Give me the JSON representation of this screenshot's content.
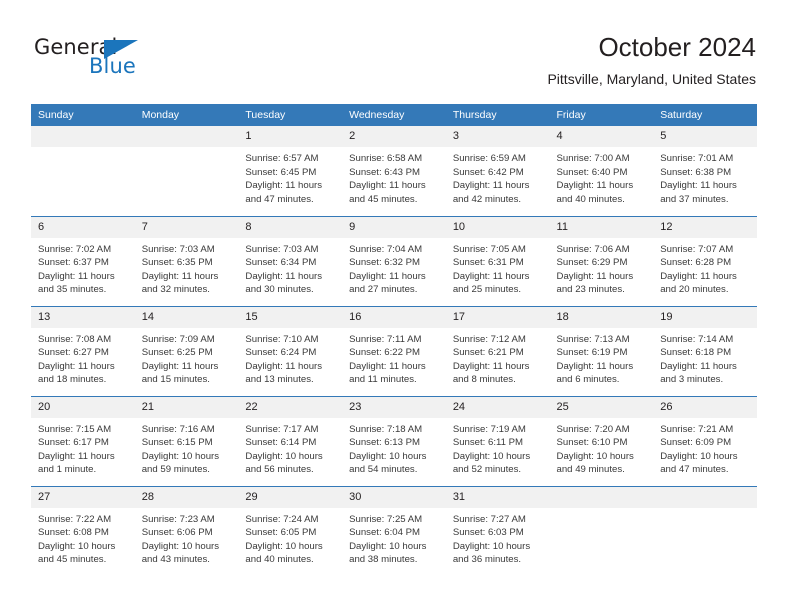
{
  "brand": {
    "name_part1": "General",
    "name_part2": "Blue",
    "flag_icon": "triangle-flag-icon",
    "accent_color": "#1b75bc"
  },
  "header": {
    "title": "October 2024",
    "location": "Pittsville, Maryland, United States"
  },
  "calendar": {
    "header_bg": "#3479b8",
    "daynum_bg": "#f1f1f1",
    "weekday_headers": [
      "Sunday",
      "Monday",
      "Tuesday",
      "Wednesday",
      "Thursday",
      "Friday",
      "Saturday"
    ],
    "weeks": [
      [
        {
          "date": "",
          "sunrise": "",
          "sunset": "",
          "daylight1": "",
          "daylight2": "",
          "empty": true
        },
        {
          "date": "",
          "sunrise": "",
          "sunset": "",
          "daylight1": "",
          "daylight2": "",
          "empty": true
        },
        {
          "date": "1",
          "sunrise": "Sunrise: 6:57 AM",
          "sunset": "Sunset: 6:45 PM",
          "daylight1": "Daylight: 11 hours",
          "daylight2": "and 47 minutes."
        },
        {
          "date": "2",
          "sunrise": "Sunrise: 6:58 AM",
          "sunset": "Sunset: 6:43 PM",
          "daylight1": "Daylight: 11 hours",
          "daylight2": "and 45 minutes."
        },
        {
          "date": "3",
          "sunrise": "Sunrise: 6:59 AM",
          "sunset": "Sunset: 6:42 PM",
          "daylight1": "Daylight: 11 hours",
          "daylight2": "and 42 minutes."
        },
        {
          "date": "4",
          "sunrise": "Sunrise: 7:00 AM",
          "sunset": "Sunset: 6:40 PM",
          "daylight1": "Daylight: 11 hours",
          "daylight2": "and 40 minutes."
        },
        {
          "date": "5",
          "sunrise": "Sunrise: 7:01 AM",
          "sunset": "Sunset: 6:38 PM",
          "daylight1": "Daylight: 11 hours",
          "daylight2": "and 37 minutes."
        }
      ],
      [
        {
          "date": "6",
          "sunrise": "Sunrise: 7:02 AM",
          "sunset": "Sunset: 6:37 PM",
          "daylight1": "Daylight: 11 hours",
          "daylight2": "and 35 minutes."
        },
        {
          "date": "7",
          "sunrise": "Sunrise: 7:03 AM",
          "sunset": "Sunset: 6:35 PM",
          "daylight1": "Daylight: 11 hours",
          "daylight2": "and 32 minutes."
        },
        {
          "date": "8",
          "sunrise": "Sunrise: 7:03 AM",
          "sunset": "Sunset: 6:34 PM",
          "daylight1": "Daylight: 11 hours",
          "daylight2": "and 30 minutes."
        },
        {
          "date": "9",
          "sunrise": "Sunrise: 7:04 AM",
          "sunset": "Sunset: 6:32 PM",
          "daylight1": "Daylight: 11 hours",
          "daylight2": "and 27 minutes."
        },
        {
          "date": "10",
          "sunrise": "Sunrise: 7:05 AM",
          "sunset": "Sunset: 6:31 PM",
          "daylight1": "Daylight: 11 hours",
          "daylight2": "and 25 minutes."
        },
        {
          "date": "11",
          "sunrise": "Sunrise: 7:06 AM",
          "sunset": "Sunset: 6:29 PM",
          "daylight1": "Daylight: 11 hours",
          "daylight2": "and 23 minutes."
        },
        {
          "date": "12",
          "sunrise": "Sunrise: 7:07 AM",
          "sunset": "Sunset: 6:28 PM",
          "daylight1": "Daylight: 11 hours",
          "daylight2": "and 20 minutes."
        }
      ],
      [
        {
          "date": "13",
          "sunrise": "Sunrise: 7:08 AM",
          "sunset": "Sunset: 6:27 PM",
          "daylight1": "Daylight: 11 hours",
          "daylight2": "and 18 minutes."
        },
        {
          "date": "14",
          "sunrise": "Sunrise: 7:09 AM",
          "sunset": "Sunset: 6:25 PM",
          "daylight1": "Daylight: 11 hours",
          "daylight2": "and 15 minutes."
        },
        {
          "date": "15",
          "sunrise": "Sunrise: 7:10 AM",
          "sunset": "Sunset: 6:24 PM",
          "daylight1": "Daylight: 11 hours",
          "daylight2": "and 13 minutes."
        },
        {
          "date": "16",
          "sunrise": "Sunrise: 7:11 AM",
          "sunset": "Sunset: 6:22 PM",
          "daylight1": "Daylight: 11 hours",
          "daylight2": "and 11 minutes."
        },
        {
          "date": "17",
          "sunrise": "Sunrise: 7:12 AM",
          "sunset": "Sunset: 6:21 PM",
          "daylight1": "Daylight: 11 hours",
          "daylight2": "and 8 minutes."
        },
        {
          "date": "18",
          "sunrise": "Sunrise: 7:13 AM",
          "sunset": "Sunset: 6:19 PM",
          "daylight1": "Daylight: 11 hours",
          "daylight2": "and 6 minutes."
        },
        {
          "date": "19",
          "sunrise": "Sunrise: 7:14 AM",
          "sunset": "Sunset: 6:18 PM",
          "daylight1": "Daylight: 11 hours",
          "daylight2": "and 3 minutes."
        }
      ],
      [
        {
          "date": "20",
          "sunrise": "Sunrise: 7:15 AM",
          "sunset": "Sunset: 6:17 PM",
          "daylight1": "Daylight: 11 hours",
          "daylight2": "and 1 minute."
        },
        {
          "date": "21",
          "sunrise": "Sunrise: 7:16 AM",
          "sunset": "Sunset: 6:15 PM",
          "daylight1": "Daylight: 10 hours",
          "daylight2": "and 59 minutes."
        },
        {
          "date": "22",
          "sunrise": "Sunrise: 7:17 AM",
          "sunset": "Sunset: 6:14 PM",
          "daylight1": "Daylight: 10 hours",
          "daylight2": "and 56 minutes."
        },
        {
          "date": "23",
          "sunrise": "Sunrise: 7:18 AM",
          "sunset": "Sunset: 6:13 PM",
          "daylight1": "Daylight: 10 hours",
          "daylight2": "and 54 minutes."
        },
        {
          "date": "24",
          "sunrise": "Sunrise: 7:19 AM",
          "sunset": "Sunset: 6:11 PM",
          "daylight1": "Daylight: 10 hours",
          "daylight2": "and 52 minutes."
        },
        {
          "date": "25",
          "sunrise": "Sunrise: 7:20 AM",
          "sunset": "Sunset: 6:10 PM",
          "daylight1": "Daylight: 10 hours",
          "daylight2": "and 49 minutes."
        },
        {
          "date": "26",
          "sunrise": "Sunrise: 7:21 AM",
          "sunset": "Sunset: 6:09 PM",
          "daylight1": "Daylight: 10 hours",
          "daylight2": "and 47 minutes."
        }
      ],
      [
        {
          "date": "27",
          "sunrise": "Sunrise: 7:22 AM",
          "sunset": "Sunset: 6:08 PM",
          "daylight1": "Daylight: 10 hours",
          "daylight2": "and 45 minutes."
        },
        {
          "date": "28",
          "sunrise": "Sunrise: 7:23 AM",
          "sunset": "Sunset: 6:06 PM",
          "daylight1": "Daylight: 10 hours",
          "daylight2": "and 43 minutes."
        },
        {
          "date": "29",
          "sunrise": "Sunrise: 7:24 AM",
          "sunset": "Sunset: 6:05 PM",
          "daylight1": "Daylight: 10 hours",
          "daylight2": "and 40 minutes."
        },
        {
          "date": "30",
          "sunrise": "Sunrise: 7:25 AM",
          "sunset": "Sunset: 6:04 PM",
          "daylight1": "Daylight: 10 hours",
          "daylight2": "and 38 minutes."
        },
        {
          "date": "31",
          "sunrise": "Sunrise: 7:27 AM",
          "sunset": "Sunset: 6:03 PM",
          "daylight1": "Daylight: 10 hours",
          "daylight2": "and 36 minutes."
        },
        {
          "date": "",
          "sunrise": "",
          "sunset": "",
          "daylight1": "",
          "daylight2": "",
          "empty": true
        },
        {
          "date": "",
          "sunrise": "",
          "sunset": "",
          "daylight1": "",
          "daylight2": "",
          "empty": true
        }
      ]
    ]
  }
}
